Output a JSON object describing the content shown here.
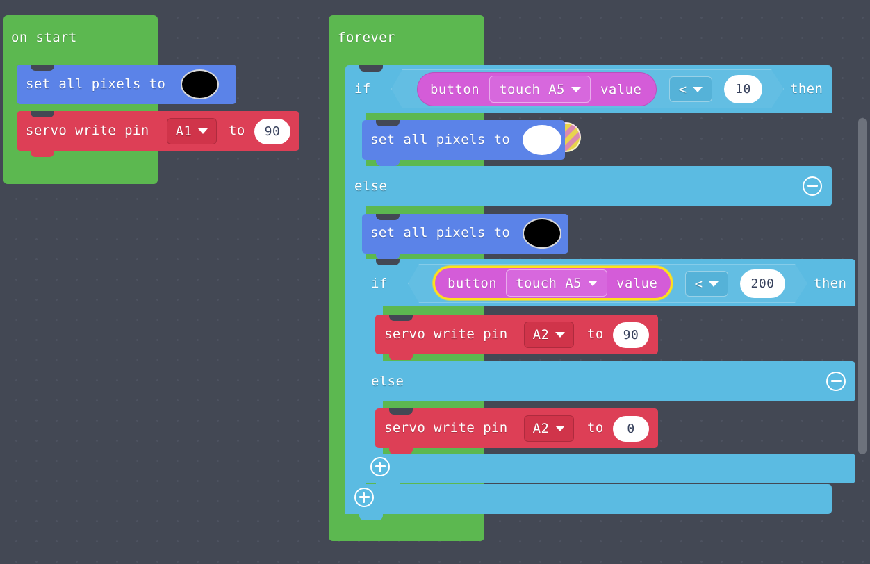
{
  "workspace": {
    "name": "makecode-blocks-workspace",
    "background_color": "#434854",
    "grid_dot_color": "#4d5260"
  },
  "colors": {
    "event_green": "#5cb850",
    "pixel_blue": "#5b83e8",
    "servo_red": "#dd3f56",
    "logic_cyan": "#5bbbe2",
    "input_pink": "#d45cd8",
    "selection_yellow": "#ffe01b",
    "field_white": "#ffffff",
    "number_text": "#37415c"
  },
  "scripts": [
    {
      "id": "on-start-script",
      "hat_label": "on start",
      "statements": [
        {
          "id": "set-all-pixels-black-onstart",
          "text": "set all pixels to",
          "color_value": "#000000",
          "color_name": "black"
        },
        {
          "id": "servo-write-a1",
          "text_before": "servo write pin",
          "pin": "A1",
          "text_middle": "to",
          "angle": "90"
        }
      ]
    },
    {
      "id": "forever-script",
      "hat_label": "forever",
      "if_outer": {
        "if_label": "if",
        "then_label": "then",
        "else_label": "else",
        "condition": {
          "reporter_left": "button",
          "reporter_dropdown": "touch A5",
          "reporter_right": "value",
          "operator": "<",
          "operand": "10",
          "selected": false
        },
        "then_body": [
          {
            "id": "set-all-pixels-white",
            "text": "set all pixels to",
            "color_value": "#ffffff",
            "color_name": "white"
          }
        ],
        "else_body": [
          {
            "id": "set-all-pixels-black-forever",
            "text": "set all pixels to",
            "color_value": "#000000",
            "color_name": "black"
          }
        ],
        "if_inner": {
          "if_label": "if",
          "then_label": "then",
          "else_label": "else",
          "condition": {
            "reporter_left": "button",
            "reporter_dropdown": "touch A5",
            "reporter_right": "value",
            "operator": "<",
            "operand": "200",
            "selected": true
          },
          "then_body": [
            {
              "id": "servo-write-a2-90",
              "text_before": "servo write pin",
              "pin": "A2",
              "text_middle": "to",
              "angle": "90"
            }
          ],
          "else_body": [
            {
              "id": "servo-write-a2-0",
              "text_before": "servo write pin",
              "pin": "A2",
              "text_middle": "to",
              "angle": "0"
            }
          ]
        }
      }
    }
  ],
  "mutators": {
    "add_icon": "plus-icon",
    "remove_icon": "minus-icon"
  }
}
